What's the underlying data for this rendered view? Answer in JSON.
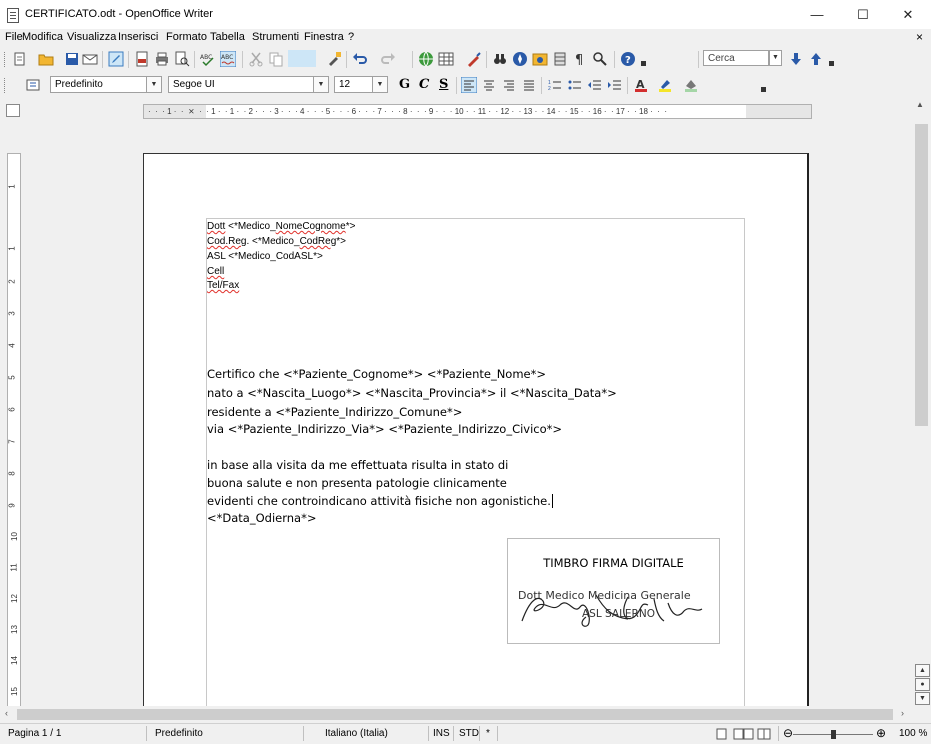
{
  "window": {
    "title": "CERTIFICATO.odt - OpenOffice Writer",
    "minimize": "—",
    "maximize": "☐",
    "close": "✕"
  },
  "menu": [
    "File",
    "Modifica",
    "Visualizza",
    "Inserisci",
    "Formato",
    "Tabella",
    "Strumenti",
    "Finestra",
    "?"
  ],
  "menu_close": "×",
  "toolbar": {
    "search_placeholder": "Cerca"
  },
  "format": {
    "style": "Predefinito",
    "font": "Segoe UI",
    "size": "12",
    "bold": "G",
    "italic": "C",
    "underline": "S"
  },
  "ruler": {
    "h_text": "·  ·  · 1 ·  ·  ⨯  ·  · 1 ·  · 1 ·  · 2 ·  ·  · 3 ·  ·  · 4 ·  ·  · 5 ·  ·  · 6 ·  ·  · 7 ·  ·  · 8 ·  ·  · 9 ·  ·  · 10 ·  · 11 ·  · 12 ·  · 13 ·  · 14 ·  · 15 ·  · 16 ·  · 17 ·  · 18 ·  ·  ·",
    "v_numbers": [
      "1",
      "1",
      "2",
      "3",
      "4",
      "5",
      "6",
      "7",
      "8",
      "9",
      "10",
      "11",
      "12",
      "13",
      "14",
      "15"
    ]
  },
  "document": {
    "header_lines": [
      "Dott <*Medico_NomeCognome*>",
      "Cod.Reg. <*Medico_CodReg*>",
      "ASL <*Medico_CodASL*>",
      "Cell",
      "Tel/Fax"
    ],
    "body_lines": [
      "Certifico che  <*Paziente_Cognome*>  <*Paziente_Nome*>",
      "nato a <*Nascita_Luogo*> <*Nascita_Provincia*>  il <*Nascita_Data*>",
      "residente a   <*Paziente_Indirizzo_Comune*>",
      "via  <*Paziente_Indirizzo_Via*> <*Paziente_Indirizzo_Civico*>"
    ],
    "body2_lines": [
      "in base alla visita da me effettuata risulta in stato di",
      "buona salute e non presenta patologie clinicamente",
      "evidenti che controindicano attività fisiche non agonistiche.",
      "<*Data_Odierna*>"
    ],
    "stamp_title": "TIMBRO FIRMA DIGITALE",
    "stamp_line1": "Dott Medico Medicina Generale",
    "stamp_line2": "ASL SALERNO"
  },
  "status": {
    "page": "Pagina 1 / 1",
    "style": "Predefinito",
    "language": "Italiano (Italia)",
    "ins": "INS",
    "std": "STD",
    "star": "*",
    "zoom": "100 %"
  }
}
